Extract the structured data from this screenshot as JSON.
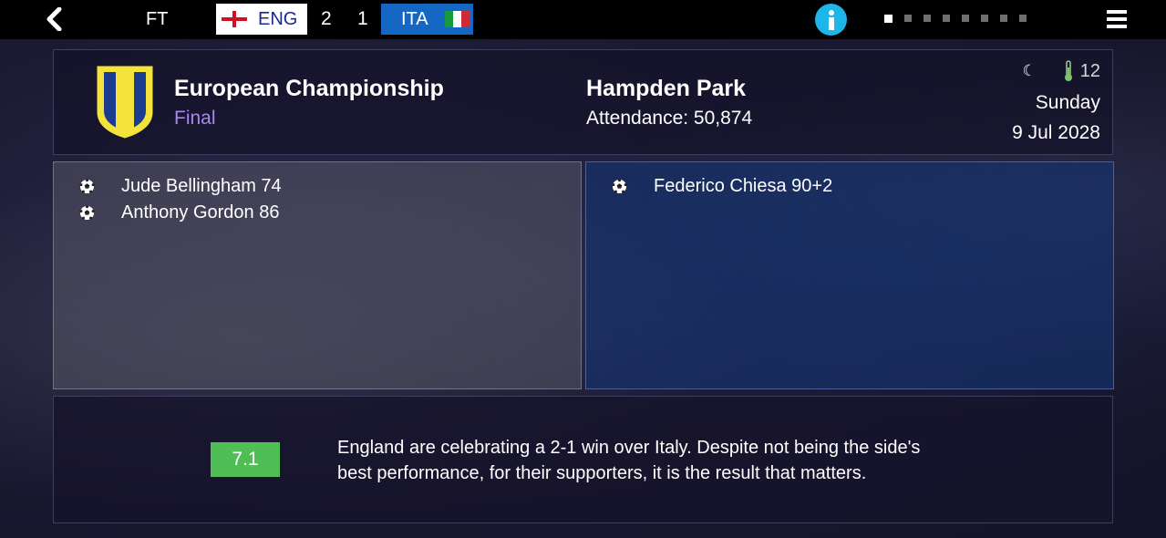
{
  "topbar": {
    "status": "FT",
    "home_team": "ENG",
    "home_score": "2",
    "away_score": "1",
    "away_team": "ITA",
    "info_icon": "info-icon",
    "back_icon": "chevron-left-icon",
    "menu_icon": "hamburger-menu-icon",
    "page_dots": 8,
    "active_page": 1
  },
  "match": {
    "competition": "European Championship",
    "stage": "Final",
    "venue": "Hampden Park",
    "attendance": "Attendance: 50,874",
    "weather_icon": "moon-icon",
    "temperature": "12",
    "day": "Sunday",
    "date": "9 Jul 2028"
  },
  "scorers": {
    "home": [
      {
        "text": "Jude Bellingham 74"
      },
      {
        "text": "Anthony Gordon 86"
      }
    ],
    "away": [
      {
        "text": "Federico Chiesa 90+2"
      }
    ]
  },
  "report": {
    "rating": "7.1",
    "text": "England are celebrating a 2-1 win over Italy. Despite not being the side's best performance, for their supporters, it is the result that matters."
  },
  "colors": {
    "topbar_bg": "#000000",
    "home_team_text": "#1b2a8f",
    "away_team_bg": "#1468c4",
    "info_icon_bg": "#1eb5e8",
    "stage_text": "#a987f0",
    "rating_bg": "#4fbe55",
    "crest_yellow": "#f3e33a",
    "crest_blue": "#1b3c8f"
  }
}
